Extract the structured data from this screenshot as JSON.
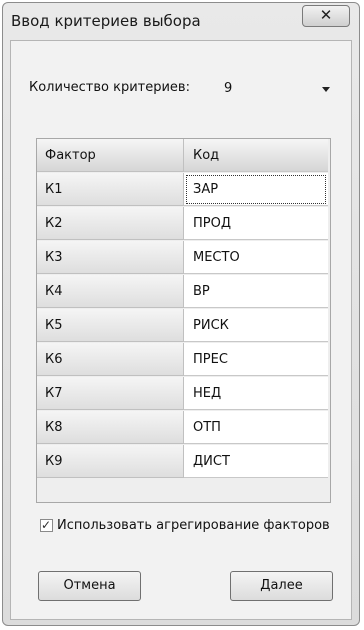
{
  "window": {
    "title": "Ввод критериев выбора",
    "close_glyph": "✕"
  },
  "criteria_count": {
    "label": "Количество критериев:",
    "value": "9"
  },
  "table": {
    "headers": [
      "Фактор",
      "Код"
    ],
    "rows": [
      [
        "К1",
        "ЗАР"
      ],
      [
        "К2",
        "ПРОД"
      ],
      [
        "К3",
        "МЕСТО"
      ],
      [
        "К4",
        "ВР"
      ],
      [
        "К5",
        "РИСК"
      ],
      [
        "К6",
        "ПРЕС"
      ],
      [
        "К7",
        "НЕД"
      ],
      [
        "К8",
        "ОТП"
      ],
      [
        "К9",
        "ДИСТ"
      ]
    ]
  },
  "aggregate": {
    "label": "Использовать агрегирование факторов",
    "checked": true,
    "check_glyph": "✓"
  },
  "buttons": {
    "cancel": "Отмена",
    "next": "Далее"
  }
}
